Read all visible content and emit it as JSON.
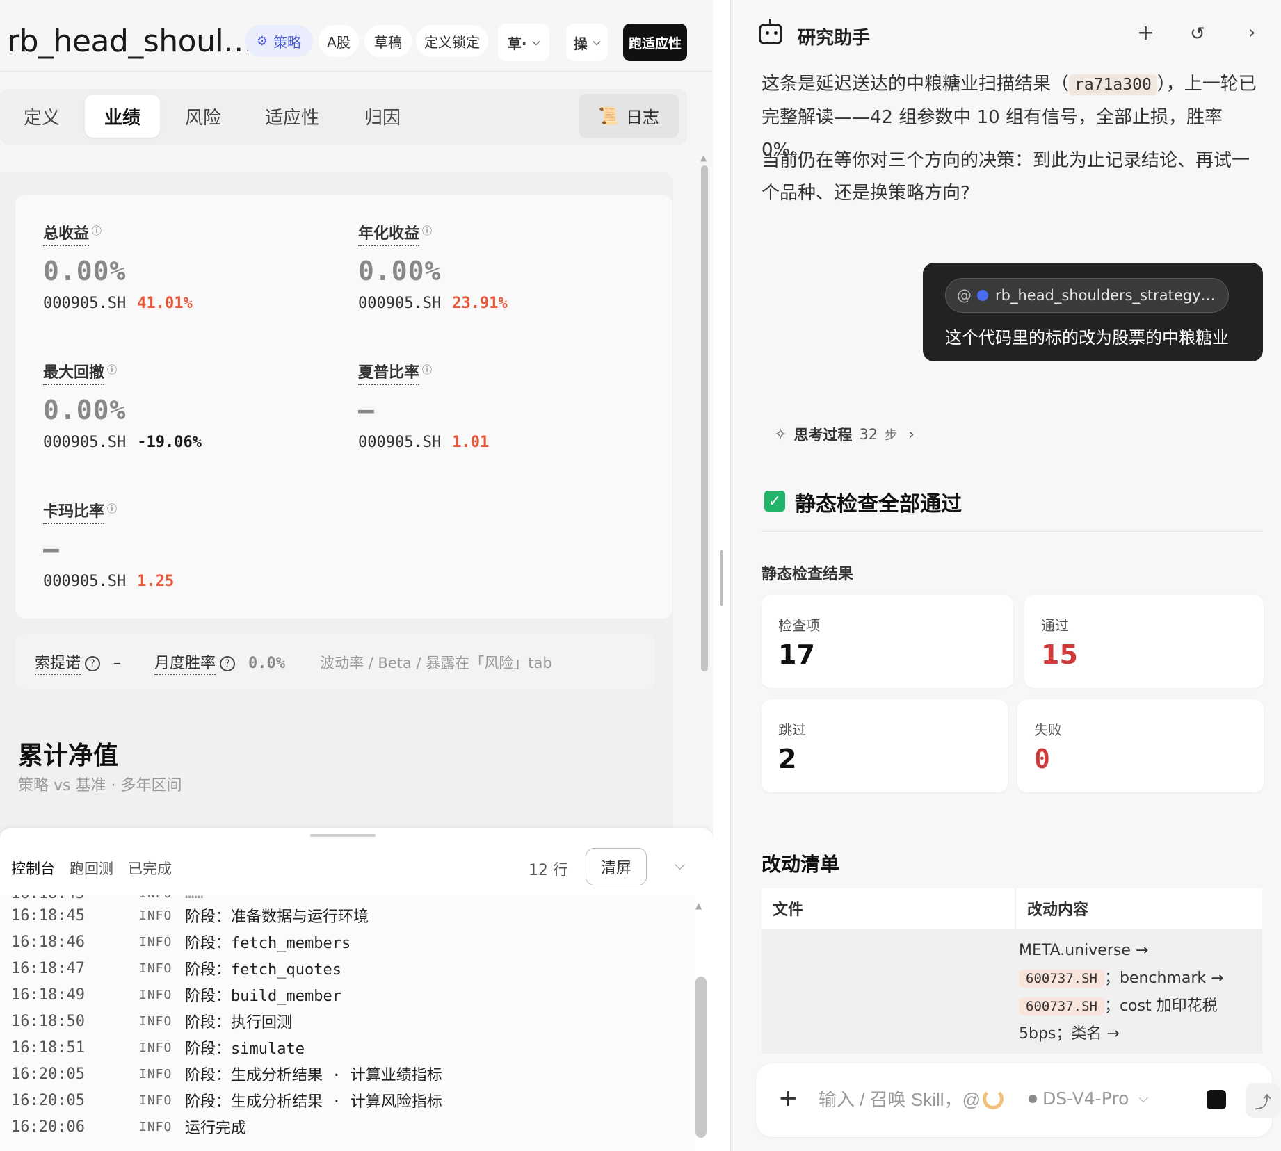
{
  "left": {
    "title": "rb_head_shoul…",
    "chips": {
      "strategy": "策略",
      "market": "A股",
      "draft": "草稿",
      "locked": "定义锁定",
      "dropdown1": "草·",
      "dropdown2": "操",
      "run": "跑适应性"
    },
    "tabs": [
      "定义",
      "业绩",
      "风险",
      "适应性",
      "归因"
    ],
    "active_tab": "业绩",
    "log_button": "日志",
    "metrics": [
      {
        "label": "总收益",
        "value": "0.00%",
        "bench_code": "000905.SH",
        "bench_value": "41.01%",
        "bench_color": "red"
      },
      {
        "label": "年化收益",
        "value": "0.00%",
        "bench_code": "000905.SH",
        "bench_value": "23.91%",
        "bench_color": "red"
      },
      {
        "label": "最大回撤",
        "value": "0.00%",
        "bench_code": "000905.SH",
        "bench_value": "-19.06%",
        "bench_color": "black"
      },
      {
        "label": "夏普比率",
        "value": "—",
        "bench_code": "000905.SH",
        "bench_value": "1.01",
        "bench_color": "red"
      },
      {
        "label": "卡玛比率",
        "value": "—",
        "bench_code": "000905.SH",
        "bench_value": "1.25",
        "bench_color": "red"
      }
    ],
    "sub_stats": {
      "sortino_label": "索提诺",
      "sortino_value": "–",
      "monthly_win_label": "月度胜率",
      "monthly_win_value": "0.0%",
      "note": "波动率 / Beta / 暴露在「风险」tab"
    },
    "nav": {
      "title": "累计净值",
      "subtitle": "策略 vs 基准 · 多年区间"
    }
  },
  "console": {
    "tabs": [
      "控制台",
      "跑回测",
      "已完成"
    ],
    "rows_count": "12",
    "rows_unit": "行",
    "clear_label": "清屏",
    "logs": [
      {
        "ts": "16:18:45",
        "level": "INFO",
        "msg": "阶段：准备数据与运行环境"
      },
      {
        "ts": "16:18:46",
        "level": "INFO",
        "msg": "阶段：fetch_members"
      },
      {
        "ts": "16:18:47",
        "level": "INFO",
        "msg": "阶段：fetch_quotes"
      },
      {
        "ts": "16:18:49",
        "level": "INFO",
        "msg": "阶段：build_member"
      },
      {
        "ts": "16:18:50",
        "level": "INFO",
        "msg": "阶段：执行回测"
      },
      {
        "ts": "16:18:51",
        "level": "INFO",
        "msg": "阶段：simulate"
      },
      {
        "ts": "16:20:05",
        "level": "INFO",
        "msg": "阶段：生成分析结果 · 计算业绩指标"
      },
      {
        "ts": "16:20:05",
        "level": "INFO",
        "msg": "阶段：生成分析结果 · 计算风险指标"
      },
      {
        "ts": "16:20:06",
        "level": "INFO",
        "msg": "运行完成"
      }
    ]
  },
  "right": {
    "title": "研究助手",
    "para1_a": "这条是延迟送达的中粮糖业扫描结果（",
    "para1_code": "ra71a300",
    "para1_b": "），上一轮已完整解读——42 组参数中 10 组有信号，全部止损，胜率 0%。",
    "para2": "当前仍在等你对三个方向的决策：到此为止记录结论、再试一个品种、还是换策略方向?",
    "user_ref": "rb_head_shoulders_strategy…",
    "user_msg": "这个代码里的标的改为股票的中粮糖业",
    "thinking_label": "思考过程",
    "thinking_steps": "32",
    "thinking_unit": "步",
    "pass_heading": "静态检查全部通过",
    "results_heading": "静态检查结果",
    "stats": [
      {
        "label": "检查项",
        "value": "17",
        "color": "black"
      },
      {
        "label": "通过",
        "value": "15",
        "color": "red"
      },
      {
        "label": "跳过",
        "value": "2",
        "color": "black"
      },
      {
        "label": "失败",
        "value": "0",
        "color": "red"
      }
    ],
    "changes_heading": "改动清单",
    "table": {
      "col_file": "文件",
      "col_change": "改动内容",
      "change_1": "META.universe →",
      "change_code_1": "600737.SH",
      "change_2": "；benchmark →",
      "change_code_2": "600737.SH",
      "change_3": "；cost 加印花税 5bps；类名 →"
    },
    "input": {
      "placeholder": "输入 / 召唤 Skill，@",
      "model": "DS-V4-Pro"
    }
  }
}
